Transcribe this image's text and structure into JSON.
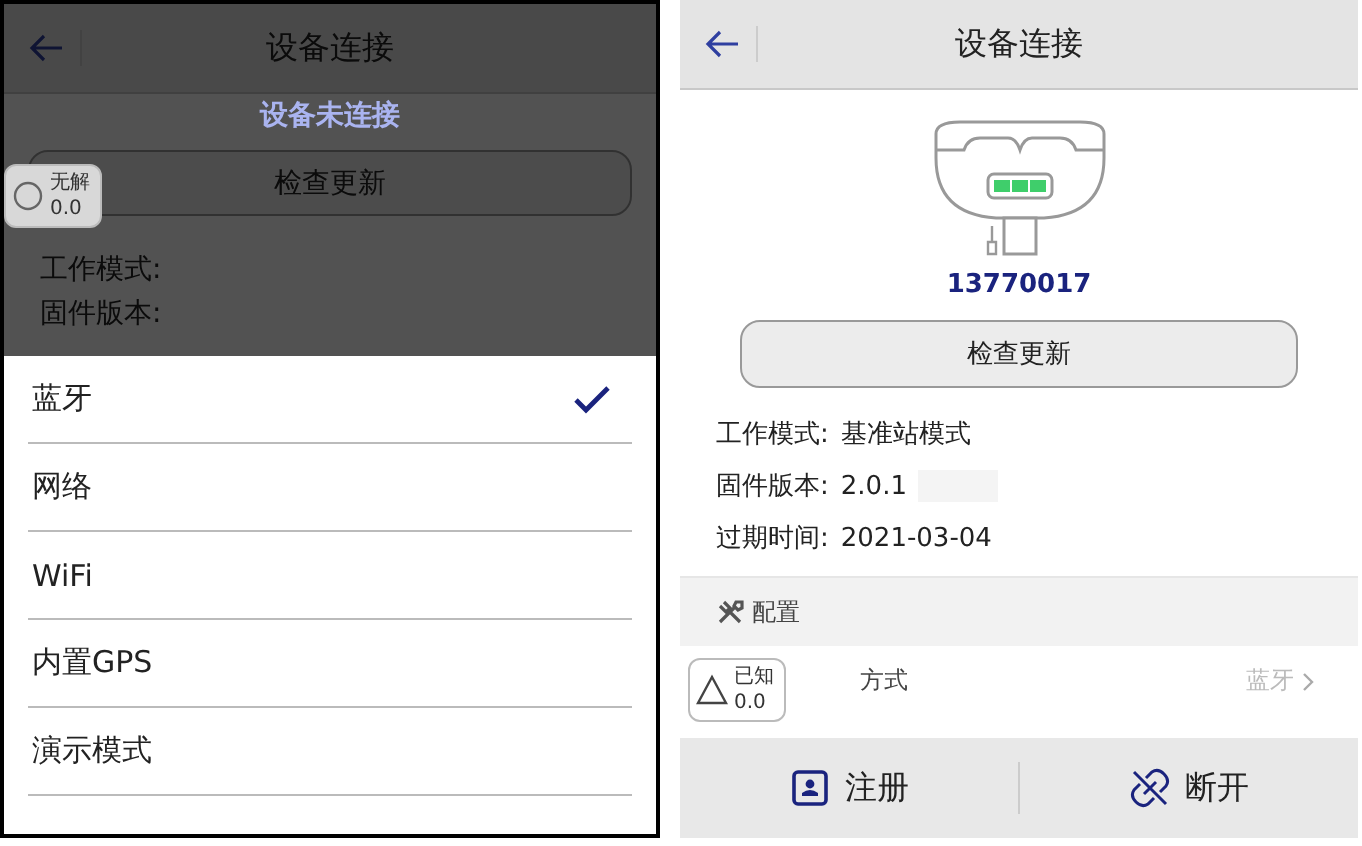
{
  "left_screen": {
    "header": {
      "title": "设备连接"
    },
    "status_text": "设备未连接",
    "update_button": "检查更新",
    "fields": [
      {
        "label": "工作模式:"
      },
      {
        "label": "固件版本:"
      }
    ],
    "solution_badge": {
      "kind": "none",
      "label": "无解",
      "value": "0.0"
    },
    "connection_menu": {
      "items": [
        {
          "label": "蓝牙",
          "selected": true
        },
        {
          "label": "网络",
          "selected": false
        },
        {
          "label": "WiFi",
          "selected": false
        },
        {
          "label": "内置GPS",
          "selected": false
        },
        {
          "label": "演示模式",
          "selected": false
        }
      ]
    }
  },
  "right_screen": {
    "header": {
      "title": "设备连接"
    },
    "device": {
      "serial": "13770017"
    },
    "update_button": "检查更新",
    "fields": [
      {
        "label": "工作模式:",
        "value": "基准站模式"
      },
      {
        "label": "固件版本:",
        "value": "2.0.1"
      },
      {
        "label": "过期时间:",
        "value": "2021-03-04"
      }
    ],
    "section": {
      "title": "配置"
    },
    "settings": [
      {
        "label": "方式",
        "value": "蓝牙"
      }
    ],
    "solution_badge": {
      "kind": "known",
      "label": "已知",
      "value": "0.0"
    },
    "actions": [
      {
        "kind": "register",
        "label": "注册"
      },
      {
        "kind": "disconnect",
        "label": "断开"
      }
    ]
  }
}
